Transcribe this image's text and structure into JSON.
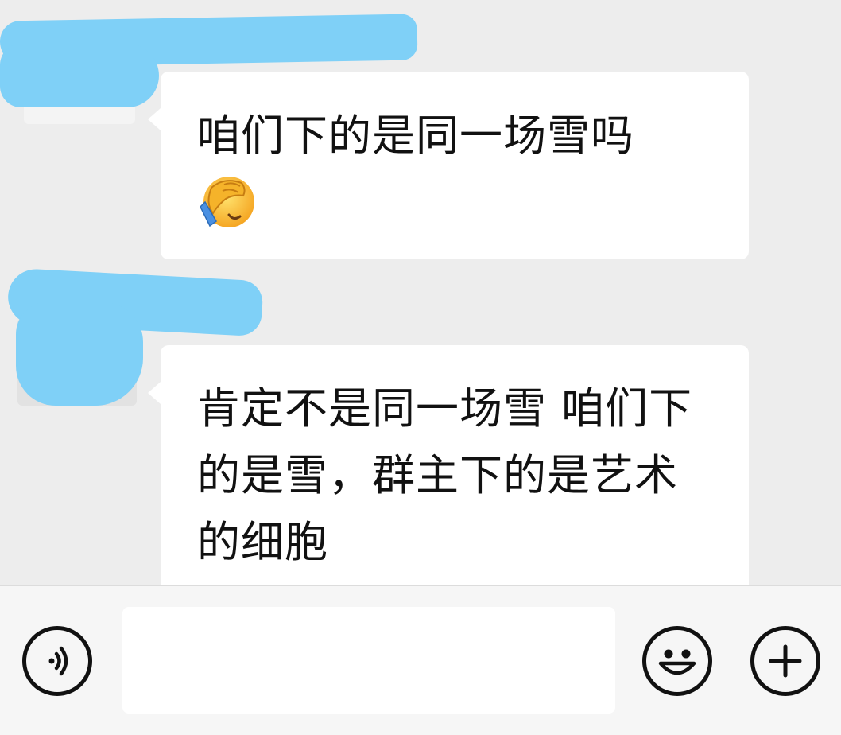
{
  "chat": {
    "messages": [
      {
        "sender": "incoming",
        "text": "咱们下的是同一场雪吗",
        "emoji": "facepalm-emoji"
      },
      {
        "sender": "incoming",
        "text": "肯定不是同一场雪 咱们下的是雪，群主下的是艺术的细胞"
      }
    ]
  },
  "input_bar": {
    "text_value": "",
    "icons": {
      "voice": "voice-icon",
      "emoji": "smiley-icon",
      "more": "plus-icon"
    }
  },
  "colors": {
    "chat_background": "#ededed",
    "bubble_background": "#ffffff",
    "input_bar_background": "#f6f6f6",
    "redaction": "#7fd0f7",
    "icon_stroke": "#111111"
  }
}
